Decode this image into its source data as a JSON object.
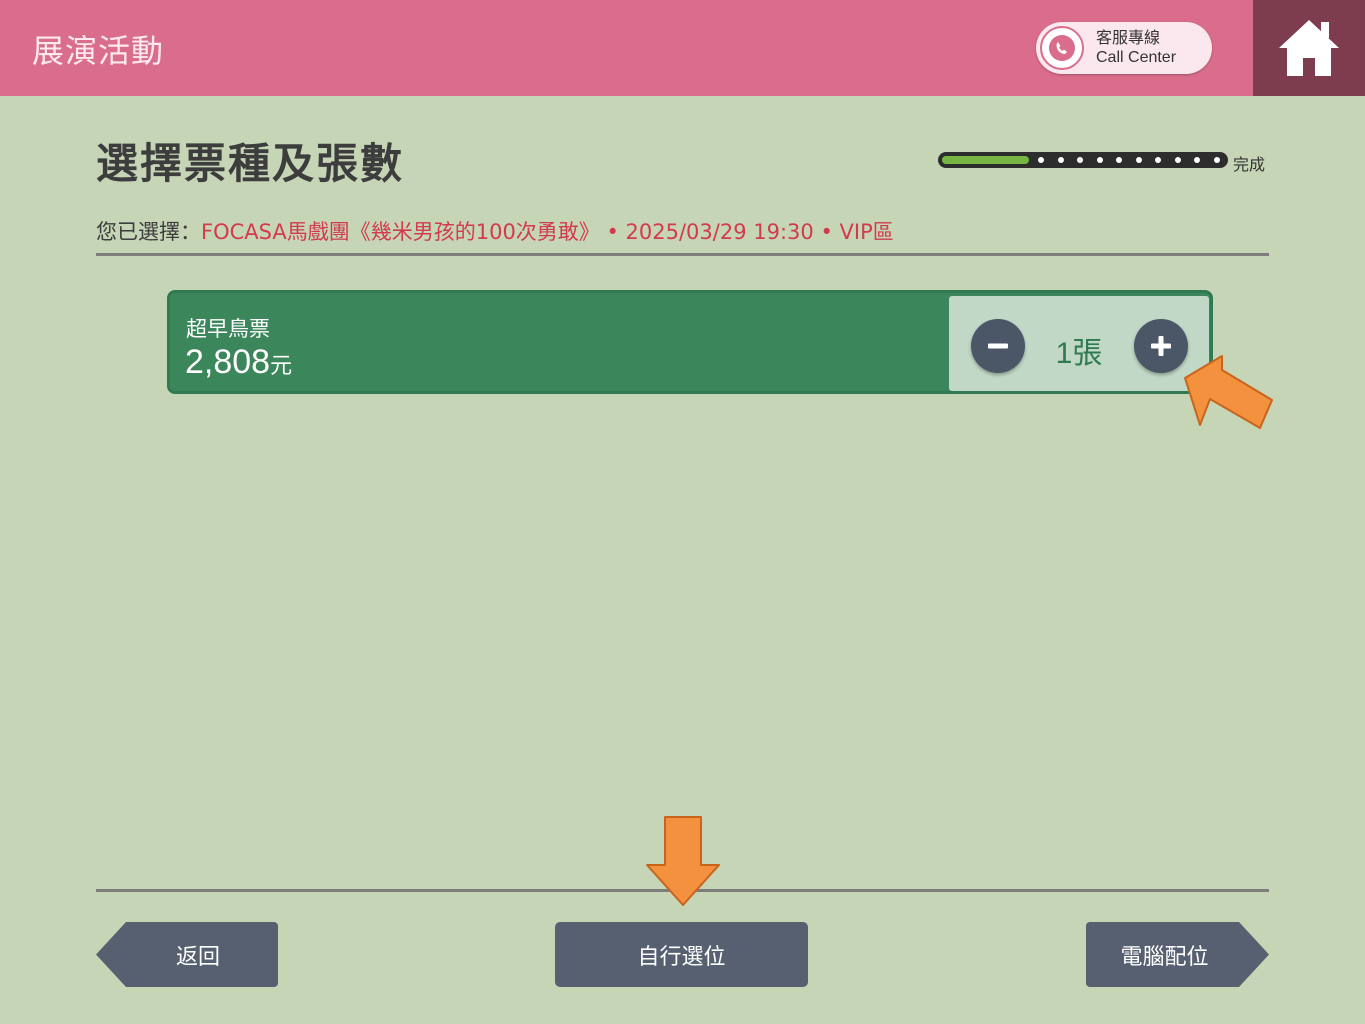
{
  "header": {
    "app_title": "展演活動",
    "call_center_line1": "客服專線",
    "call_center_line2": "Call Center"
  },
  "icons": {
    "phone": "phone-icon",
    "home": "home-icon",
    "minus": "minus-icon",
    "plus": "plus-icon"
  },
  "page": {
    "title": "選擇票種及張數",
    "progress_label": "完成",
    "progress_fraction": 0.31
  },
  "selection": {
    "prefix": "您已選擇：",
    "value": "FOCASA馬戲團《幾米男孩的100次勇敢》 • 2025/03/29 19:30 • VIP區"
  },
  "ticket": {
    "name": "超早鳥票",
    "price": "2,808",
    "price_unit": "元",
    "quantity": "1張"
  },
  "buttons": {
    "back": "返回",
    "self_select": "自行選位",
    "auto_assign": "電腦配位"
  },
  "colors": {
    "header": "#d96d8b",
    "home_bg": "#7e3d4f",
    "background": "#c6d5b6",
    "ticket_card": "#3c865c",
    "qty_panel": "#c1d8c6",
    "nav_button": "#566070",
    "highlight_arrow": "#f4913f",
    "selection_text": "#d23a4e"
  }
}
